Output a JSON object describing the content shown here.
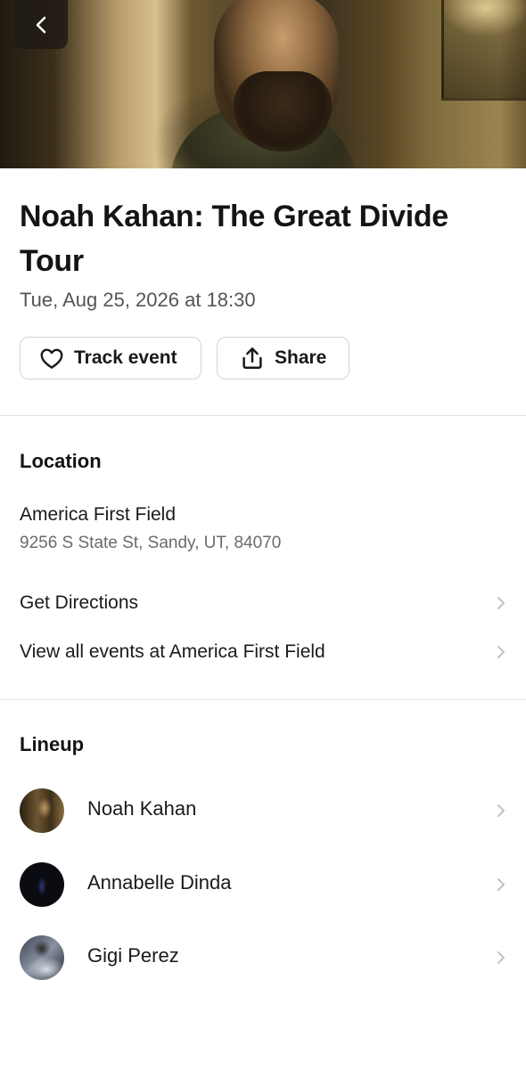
{
  "hero": {
    "image_alt": "Noah Kahan portrait"
  },
  "event": {
    "title": "Noah Kahan: The Great Divide Tour",
    "datetime": "Tue, Aug 25, 2026 at 18:30"
  },
  "actions": {
    "track_label": "Track event",
    "share_label": "Share"
  },
  "location": {
    "heading": "Location",
    "venue_name": "America First Field",
    "address": "9256 S State St, Sandy, UT, 84070",
    "links": [
      {
        "label": "Get Directions"
      },
      {
        "label": "View all events at America First Field"
      }
    ]
  },
  "lineup": {
    "heading": "Lineup",
    "artists": [
      {
        "name": "Noah Kahan"
      },
      {
        "name": "Annabelle Dinda"
      },
      {
        "name": "Gigi Perez"
      }
    ]
  },
  "colors": {
    "text_primary": "#1a1a1a",
    "text_secondary": "#6b6b6b",
    "divider": "#e2e2e2",
    "button_border": "#d4d4d4"
  },
  "icons": [
    "chevron-left-icon",
    "heart-icon",
    "share-upload-icon",
    "chevron-right-icon"
  ]
}
